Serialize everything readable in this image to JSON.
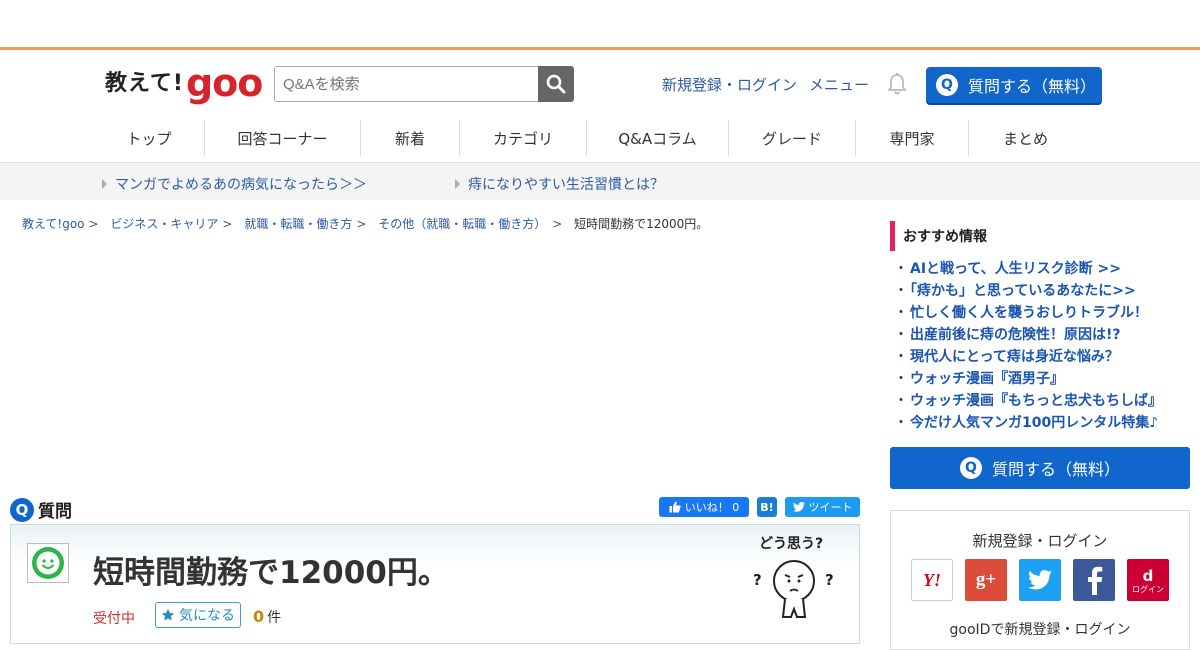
{
  "header": {
    "logo_text": "教えて!",
    "logo_brand": "goo",
    "search_placeholder": "Q&Aを検索",
    "register_login": "新規登録・ログイン",
    "menu": "メニュー",
    "ask_button": "質問する（無料）",
    "ask_icon": "Q"
  },
  "nav": [
    "トップ",
    "回答コーナー",
    "新着",
    "カテゴリ",
    "Q&Aコラム",
    "グレード",
    "専門家",
    "まとめ"
  ],
  "promo": [
    "マンガでよめるあの病気になったら＞＞",
    "痔になりやすい生活習慣とは？"
  ],
  "breadcrumb": {
    "items": [
      "教えて!goo",
      "ビジネス・キャリア",
      "就職・転職・働き方",
      "その他（就職・転職・働き方）"
    ],
    "current": "短時間勤務で12000円。",
    "separator": ">"
  },
  "question": {
    "label": "質問",
    "label_icon": "Q",
    "title": "短時間勤務で12000円。",
    "status": "受付中",
    "watch_label": "気になる",
    "count": "0",
    "count_unit": "件",
    "mascot_text": "どう思う?",
    "mascot_q": "?"
  },
  "share": {
    "like": "いいね！ 0",
    "hatena": "B!",
    "tweet": "ツイート"
  },
  "sidebar": {
    "recommend_title": "おすすめ情報",
    "bullet": "・",
    "recommend": [
      "AIと戦って、人生リスク診断 >>",
      "「痔かも」と思っているあなたに>>",
      "忙しく働く人を襲うおしりトラブル！",
      "出産前後に痔の危険性！原因は!?",
      "現代人にとって痔は身近な悩み？",
      "ウォッチ漫画『酒男子』",
      "ウォッチ漫画『もちっと忠犬もちしば』",
      "今だけ人気マンガ100円レンタル特集♪"
    ],
    "ask_button": "質問する（無料）",
    "login_title": "新規登録・ログイン",
    "login_sub": "gooIDで新規登録・ログイン",
    "sns": {
      "yahoo": "Y!",
      "google": "g+",
      "docomo_small": "ログイン",
      "docomo_letter": "d"
    }
  },
  "colors": {
    "accent_orange": "#f39a5c",
    "brand_red": "#d9222a",
    "primary_blue": "#1066cc",
    "link_blue": "#2d5aa6",
    "recommend_pink": "#e0245e",
    "yahoo": "#ffffff",
    "google": "#dd4b39",
    "twitter": "#1da1f2",
    "facebook": "#3b5998",
    "docomo": "#cc0033"
  }
}
